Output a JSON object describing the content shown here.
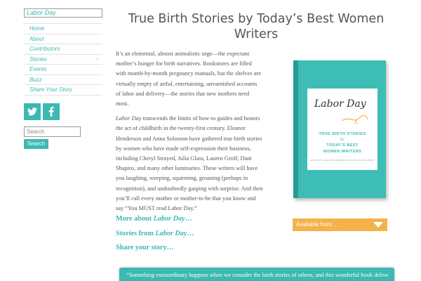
{
  "site": {
    "title": "Labor Day"
  },
  "nav": {
    "items": [
      {
        "label": "Home"
      },
      {
        "label": "About"
      },
      {
        "label": "Contributors"
      },
      {
        "label": "Stories",
        "has_submenu": true
      },
      {
        "label": "Events"
      },
      {
        "label": "Buzz"
      },
      {
        "label": "Share Your Story"
      }
    ],
    "submenu_glyph": "›"
  },
  "social": {
    "twitter_glyph": "t",
    "facebook_glyph": "f"
  },
  "search": {
    "placeholder": "Search",
    "button_label": "Search"
  },
  "page": {
    "title": "True Birth Stories by Today’s Best Women Writers",
    "paragraph1": "It’s an elemental, almost animalistic urge—the expectant mother’s hunger for birth narratives. Bookstores are filled with month-by-month pregnancy manuals, but the shelves are virtually empty of artful, entertaining, unvarnished accounts of labor and delivery—the stories that new mothers need most.",
    "paragraph2_em": "Labor Day",
    "paragraph2_rest": " transcends the limits of how-to guides and honors the act of childbirth in the twenty-first century. Eleanor Henderson and Anna Solomon have gathered true birth stories by women who have made self-expression their business, including Cheryl Strayed, Julia Glass, Lauren Groff, Dani Shapiro, and many other luminaries. These writers will have you laughing, weeping, squirming, groaning (perhaps in recognition), and undoubtedly gasping with surprise. And then you’ll call every mother or mother-to-be that you know and say “You MUST read Labor Day.”"
  },
  "links": {
    "more_prefix": "More about ",
    "more_em": "Labor Day",
    "more_suffix": "…",
    "stories_prefix": "Stories from ",
    "stories_em": "Labor Day",
    "stories_suffix": "…",
    "share": "Share your story…"
  },
  "book": {
    "title": "Labor Day",
    "subtitle_line1": "TRUE BIRTH STORIES",
    "subtitle_by": "by",
    "subtitle_line2": "TODAY’S BEST",
    "subtitle_line3": "WOMEN WRITERS",
    "editors": "EDITED BY ELEANOR HENDERSON AND ANNA SOLOMON"
  },
  "available": {
    "label": "Available from…"
  },
  "bottom": {
    "text": "“Something extraordinary happens when we consider the birth stories of others, and this wonderful book delivers”"
  },
  "colors": {
    "accent": "#3bb9b2",
    "orange": "#f5b24a",
    "book_teal": "#3dbdb5"
  }
}
